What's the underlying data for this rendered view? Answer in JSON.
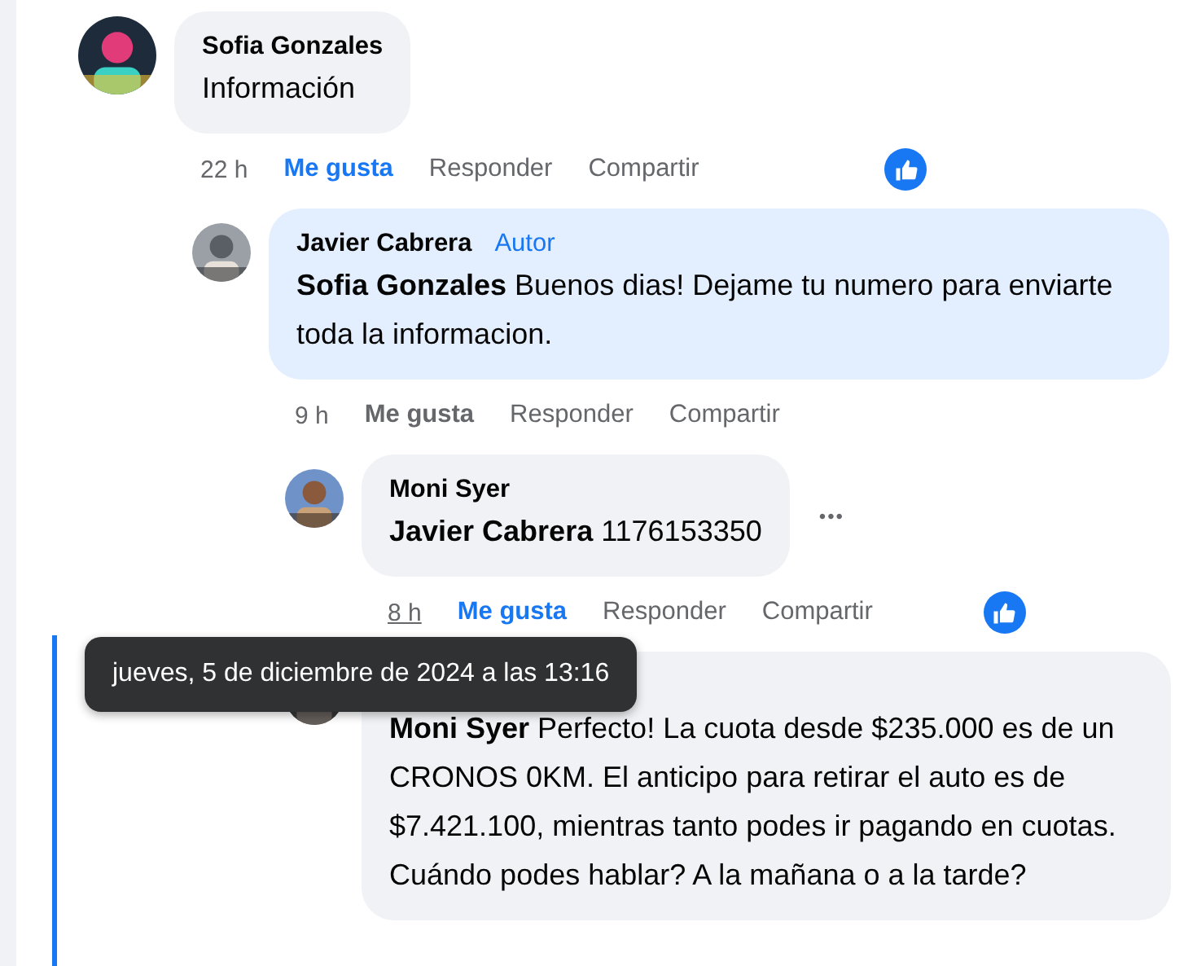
{
  "comments": [
    {
      "author": "Sofia Gonzales",
      "text": "Información",
      "time": "22 h",
      "time_hovered": false,
      "liked": true,
      "actions": [
        "Me gusta",
        "Responder",
        "Compartir"
      ],
      "like_reaction": true,
      "children": [
        {
          "author": "Javier Cabrera",
          "badge": "Autor",
          "text": "**Sofia Gonzales** Buenos dias! Dejame tu numero para enviarte toda la informacion.",
          "highlighted": true,
          "time": "9 h",
          "time_hovered": false,
          "liked": false,
          "actions": [
            "Me gusta",
            "Responder",
            "Compartir"
          ],
          "children": [
            {
              "author": "Moni Syer",
              "text": "**Javier Cabrera** 1176153350",
              "more_menu": "•••",
              "time": "8 h",
              "time_hovered": true,
              "time_tooltip": "jueves, 5 de diciembre de 2024 a las 13:16",
              "liked": true,
              "actions": [
                "Me gusta",
                "Responder",
                "Compartir"
              ],
              "like_reaction": true
            },
            {
              "text": "**Moni Syer** Perfecto! La cuota desde $235.000 es de un CRONOS 0KM. El anticipo para retirar el auto es de $7.421.100, mientras tanto podes ir pagando en cuotas. Cuándo podes hablar? A la mañana o a la tarde?",
              "focused": true
            }
          ]
        }
      ]
    }
  ]
}
